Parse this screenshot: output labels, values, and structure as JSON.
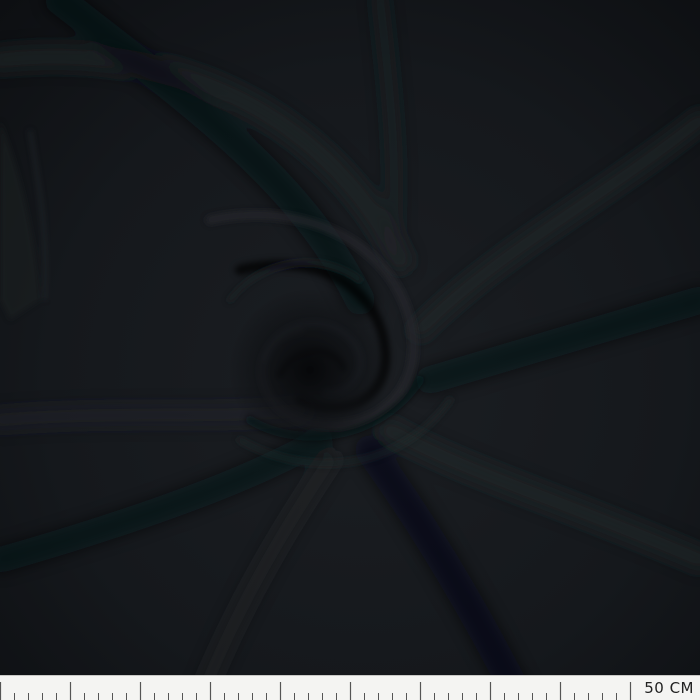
{
  "photo": {
    "subject": "black-fabric-swirl",
    "colors": {
      "fabric": "#16191d",
      "shadow": "#08090b",
      "highlight": "#2a2e33"
    }
  },
  "ruler": {
    "label": "50 CM",
    "background": "#f4f4f2",
    "tick_color": "#555555"
  }
}
